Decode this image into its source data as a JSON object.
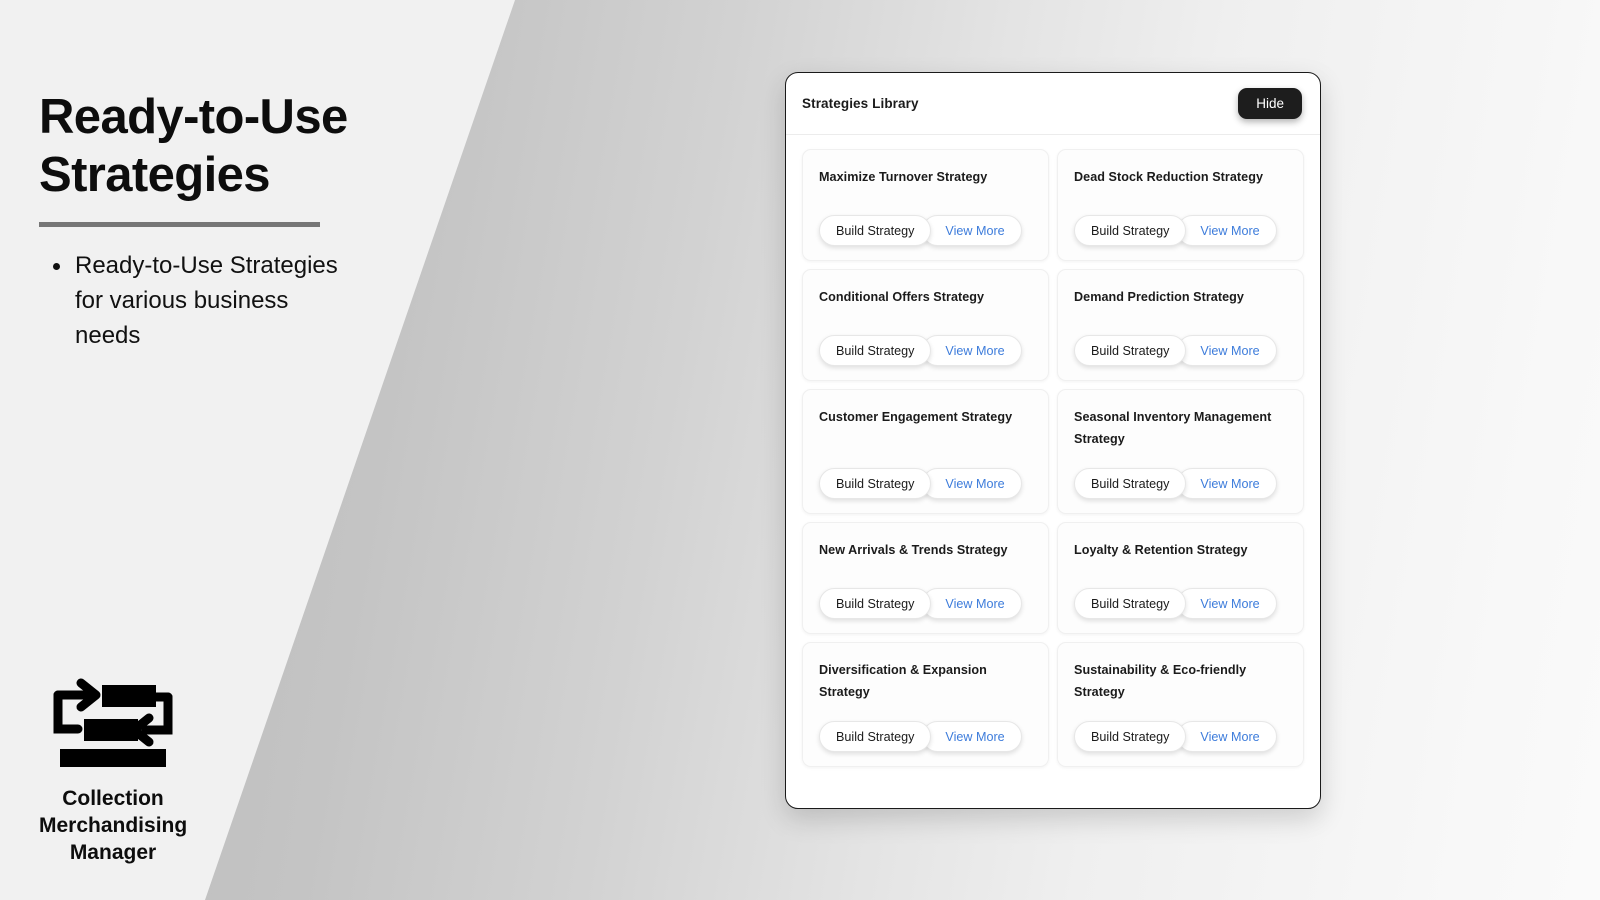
{
  "slide": {
    "title": "Ready-to-Use Strategies",
    "bullets": [
      "Ready-to-Use Strategies for various business needs"
    ]
  },
  "brand": {
    "icon": "collection-merchandising-icon",
    "name": "Collection Merchandising Manager"
  },
  "panel": {
    "title": "Strategies Library",
    "hide_label": "Hide",
    "build_label": "Build Strategy",
    "view_label": "View More",
    "cards": [
      {
        "title": "Maximize Turnover Strategy"
      },
      {
        "title": "Dead Stock Reduction Strategy"
      },
      {
        "title": "Conditional Offers Strategy"
      },
      {
        "title": "Demand Prediction Strategy"
      },
      {
        "title": "Customer Engagement Strategy"
      },
      {
        "title": "Seasonal Inventory Management Strategy"
      },
      {
        "title": "New Arrivals & Trends Strategy"
      },
      {
        "title": "Loyalty & Retention Strategy"
      },
      {
        "title": "Diversification & Expansion Strategy"
      },
      {
        "title": "Sustainability & Eco-friendly Strategy"
      }
    ]
  },
  "colors": {
    "accent_link": "#3d7cdb",
    "hide_button_bg": "#1d1d1d",
    "panel_border": "#1a1a1a",
    "rule": "#767676",
    "page_bg": "#f1f1f1"
  }
}
